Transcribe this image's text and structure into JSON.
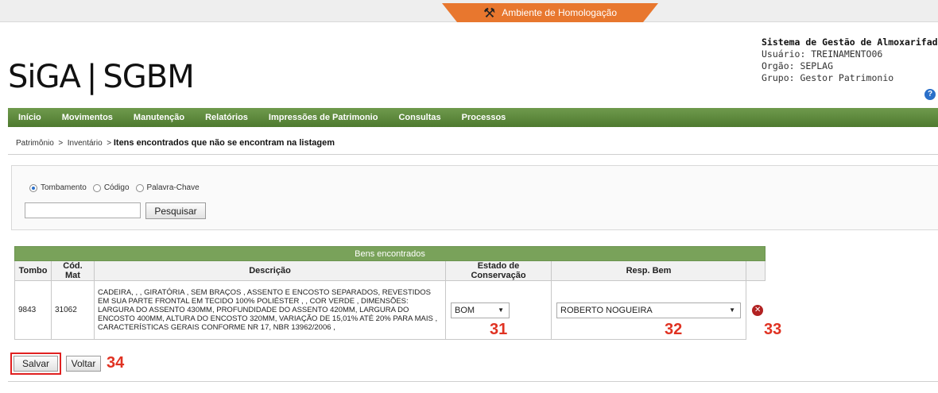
{
  "env_banner": {
    "label": "Ambiente de Homologação",
    "icon": "tools-icon"
  },
  "header": {
    "logo_left": "SiGA",
    "logo_sep": "|",
    "logo_right": "SGBM",
    "system_title": "Sistema de Gestão de Almoxarifado",
    "user": "Usuário: TREINAMENTO06",
    "org": "Orgão: SEPLAG",
    "group": "Grupo: Gestor Patrimonio",
    "help_icon": "help-icon"
  },
  "menu": [
    "Início",
    "Movimentos",
    "Manutenção",
    "Relatórios",
    "Impressões de Patrimonio",
    "Consultas",
    "Processos"
  ],
  "breadcrumb": {
    "path": "Patrimônio  >  Inventário  > ",
    "current": "Itens encontrados que não se encontram na listagem"
  },
  "search": {
    "options": [
      {
        "label": "Tombamento",
        "checked": true
      },
      {
        "label": "Código",
        "checked": false
      },
      {
        "label": "Palavra-Chave",
        "checked": false
      }
    ],
    "value": "",
    "button": "Pesquisar"
  },
  "table": {
    "caption": "Bens encontrados",
    "headers": [
      "Tombo",
      "Cód. Mat",
      "Descrição",
      "Estado de Conservação",
      "Resp. Bem"
    ],
    "rows": [
      {
        "tombo": "9843",
        "cod_mat": "31062",
        "descricao": "CADEIRA, , , GIRATÓRIA , SEM BRAÇOS , ASSENTO E ENCOSTO SEPARADOS, REVESTIDOS EM SUA PARTE FRONTAL EM TECIDO 100% POLIÉSTER , , COR VERDE , DIMENSÕES: LARGURA DO ASSENTO 430MM, PROFUNDIDADE DO ASSENTO 420MM, LARGURA DO ENCOSTO 400MM, ALTURA DO ENCOSTO 320MM, VARIAÇÃO DE 15,01% ATÉ 20% PARA MAIS , CARACTERÍSTICAS GERAIS CONFORME NR 17, NBR 13962/2006 ,",
        "estado": "BOM",
        "responsavel": "ROBERTO NOGUEIRA"
      }
    ]
  },
  "annotations": {
    "estado": "31",
    "resp": "32",
    "remove": "33",
    "save": "34"
  },
  "buttons": {
    "save": "Salvar",
    "back": "Voltar"
  },
  "colors": {
    "menu_green": "#5b8a3a",
    "env_orange": "#e8772e",
    "annotation_red": "#e03222"
  }
}
